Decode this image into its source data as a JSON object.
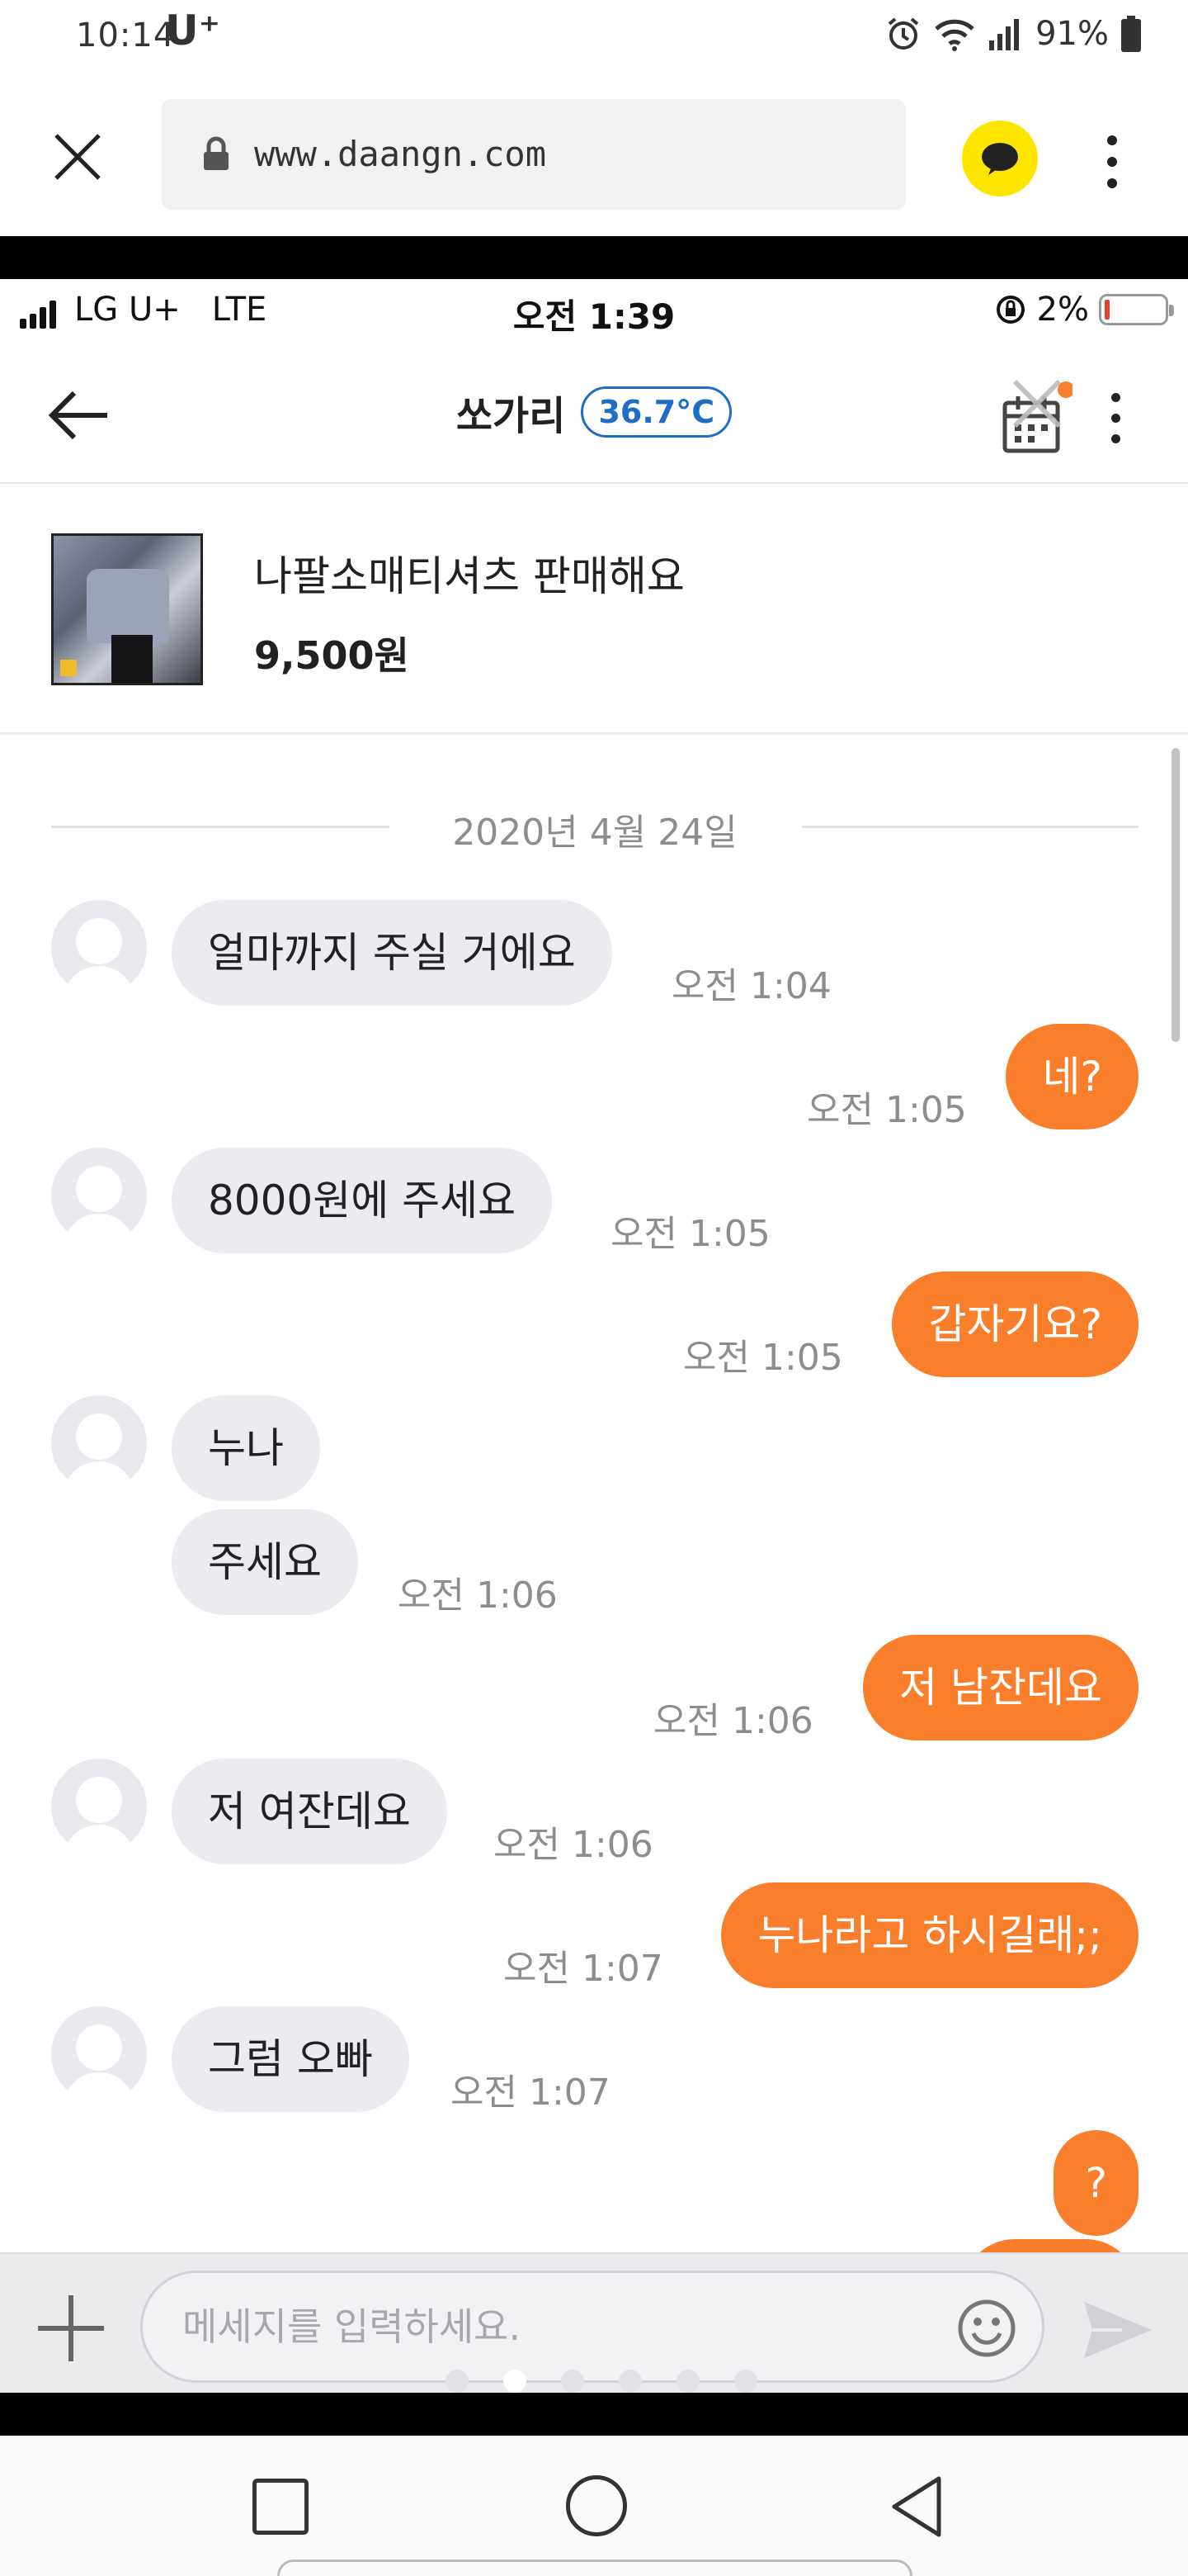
{
  "system_status": {
    "time": "10:14",
    "carrier_logo": "U⁺",
    "battery_percent": "91%",
    "icons": [
      "alarm-icon",
      "wifi-icon",
      "signal-icon",
      "battery-icon"
    ]
  },
  "browser": {
    "url": "www.daangn.com",
    "icons": [
      "close-icon",
      "lock-icon",
      "kakaotalk-icon",
      "more-vert-icon"
    ]
  },
  "ios_status": {
    "carrier": "LG U+",
    "network": "LTE",
    "time": "오전 1:39",
    "battery_percent": "2%"
  },
  "chat_header": {
    "partner_name": "쏘가리",
    "manner_temperature": "36.7°C",
    "icons": [
      "back-arrow-icon",
      "calendar-icon",
      "more-vert-icon"
    ]
  },
  "product": {
    "title": "나팔소매티셔츠 판매해요",
    "price": "9,500원"
  },
  "chat": {
    "date_divider": "2020년 4월 24일",
    "messages": [
      {
        "from": "partner",
        "text": "얼마까지 주실 거에요",
        "time": "오전 1:04"
      },
      {
        "from": "me",
        "text": "네?",
        "time": "오전 1:05"
      },
      {
        "from": "partner",
        "text": "8000원에 주세요",
        "time": "오전 1:05"
      },
      {
        "from": "me",
        "text": "갑자기요?",
        "time": "오전 1:05"
      },
      {
        "from": "partner",
        "text": "누나",
        "time": ""
      },
      {
        "from": "partner",
        "text": "주세요",
        "time": "오전 1:06"
      },
      {
        "from": "me",
        "text": "저 남잔데요",
        "time": "오전 1:06"
      },
      {
        "from": "partner",
        "text": "저 여잔데요",
        "time": "오전 1:06"
      },
      {
        "from": "me",
        "text": "누나라고 하시길래;;",
        "time": "오전 1:07"
      },
      {
        "from": "partner",
        "text": "그럼 오빠",
        "time": "오전 1:07"
      },
      {
        "from": "me",
        "text": "?",
        "time": ""
      }
    ]
  },
  "input_bar": {
    "placeholder": "메세지를 입력하세요.",
    "value": "",
    "page_indicator": {
      "count": 6,
      "active_index": 1
    }
  },
  "colors": {
    "accent_orange": "#fa7f2c",
    "incoming_bubble": "#ececf0",
    "temperature_blue": "#1d6ec4",
    "kakao_yellow": "#fee500"
  }
}
